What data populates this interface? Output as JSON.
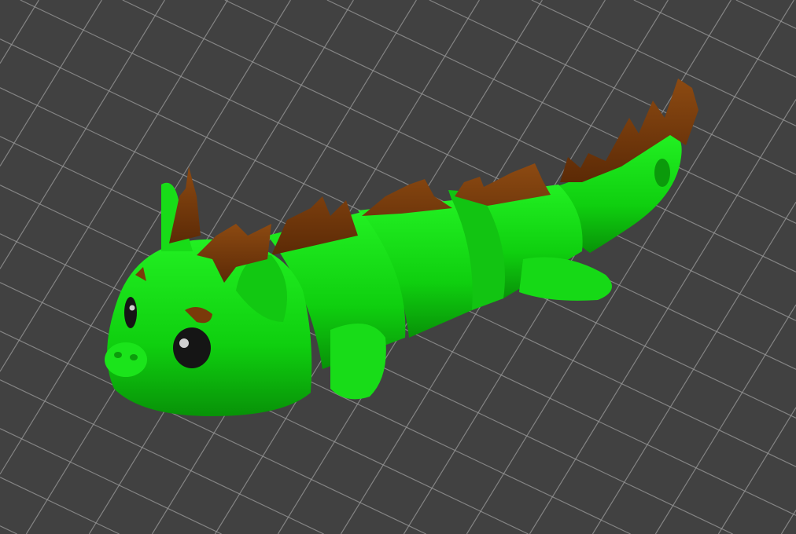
{
  "viewport": {
    "background_color": "#414141",
    "grid_color": "#9a9a9a",
    "model": {
      "body_color": "#16d916",
      "body_shadow_color": "#0a9e0a",
      "spikes_color": "#7a3a0a",
      "eye_color": "#151515"
    }
  }
}
